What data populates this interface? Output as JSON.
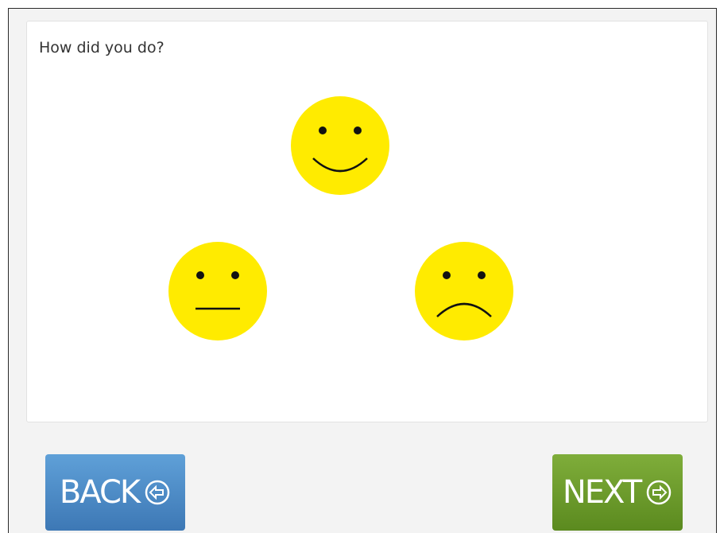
{
  "prompt": {
    "question": "How did you do?"
  },
  "faces": [
    {
      "id": "happy",
      "icon": "happy-face-icon"
    },
    {
      "id": "neutral",
      "icon": "neutral-face-icon"
    },
    {
      "id": "sad",
      "icon": "sad-face-icon"
    }
  ],
  "nav": {
    "back_label": "BACK",
    "back_icon": "arrow-left-circle-icon",
    "next_label": "NEXT",
    "next_icon": "arrow-right-circle-icon"
  },
  "colors": {
    "face_fill": "#ffeb00",
    "back_button": "#4a87c4",
    "next_button": "#6b9a2a",
    "background": "#f3f3f3"
  }
}
